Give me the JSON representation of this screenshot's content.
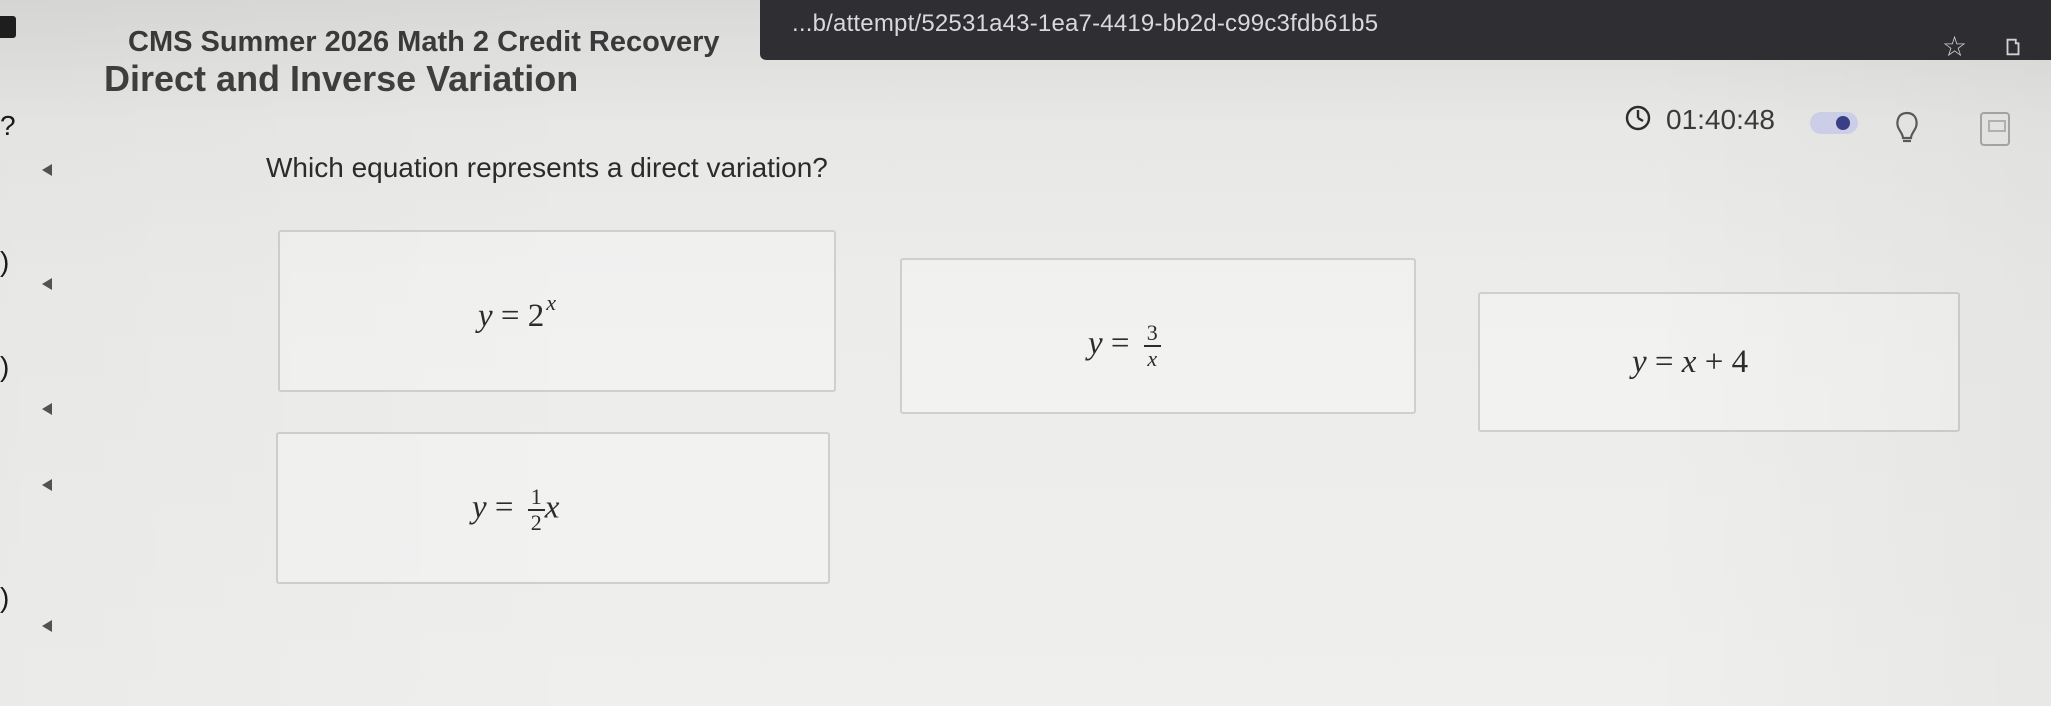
{
  "browser": {
    "url": "...b/attempt/52531a43-1ea7-4419-bb2d-c99c3fdb61b5",
    "bookmark_icon": "star-icon",
    "extension_icon": "extension-icon"
  },
  "header": {
    "course_title": "CMS Summer 2026 Math 2 Credit Recovery",
    "lesson_title": "Direct and Inverse Variation"
  },
  "toolbar": {
    "timer": "01:40:48",
    "timer_icon": "timer-icon",
    "toggle_state": "on",
    "hint_icon": "lightbulb-icon",
    "calculator_icon": "calculator-icon"
  },
  "question": {
    "prompt": "Which equation represents a direct variation?",
    "choices": [
      {
        "lhs": "y",
        "op": "=",
        "base": "2",
        "exponent": "x"
      },
      {
        "lhs": "y",
        "op": "=",
        "numerator": "3",
        "denominator": "x"
      },
      {
        "lhs": "y",
        "op": "=",
        "term": "x",
        "plus": "+",
        "constant": "4"
      },
      {
        "lhs": "y",
        "op": "=",
        "numerator": "1",
        "denominator": "2",
        "term": "x"
      }
    ]
  },
  "colors": {
    "browser_bar": "#2f2f33",
    "toggle_track": "#cfd0ea",
    "toggle_knob": "#3b3f86"
  }
}
